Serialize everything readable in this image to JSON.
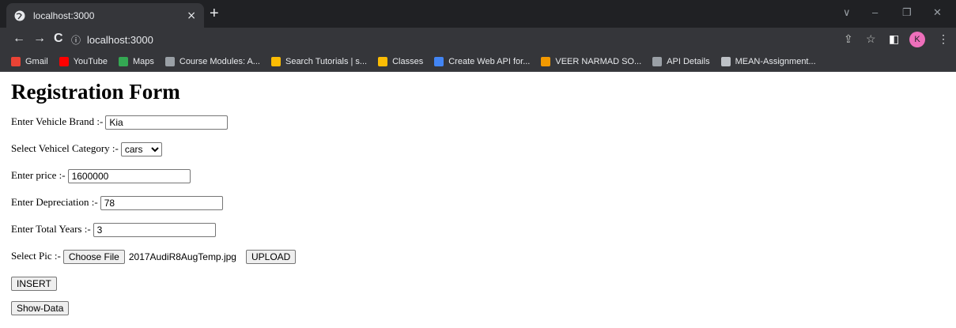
{
  "browser": {
    "tab_title": "localhost:3000",
    "tab_close": "×",
    "new_tab": "+",
    "window_controls": {
      "chevron": "∨",
      "minimize": "–",
      "restore": "❐",
      "close": "✕"
    },
    "nav": {
      "back": "←",
      "forward": "→",
      "reload": "C"
    },
    "url": "localhost:3000",
    "info_glyph": "ⓘ",
    "toolbar_icons": {
      "share": "⇪",
      "star": "☆",
      "sidebar": "◧",
      "menu": "⋮"
    },
    "avatar_letter": "K",
    "bookmarks": [
      {
        "label": "Gmail",
        "color": "#ea4335"
      },
      {
        "label": "YouTube",
        "color": "#ff0000"
      },
      {
        "label": "Maps",
        "color": "#34a853"
      },
      {
        "label": "Course Modules: A...",
        "color": "#9aa0a6"
      },
      {
        "label": "Search Tutorials | s...",
        "color": "#fbbc04"
      },
      {
        "label": "Classes",
        "color": "#fbbc04"
      },
      {
        "label": "Create Web API for...",
        "color": "#4285f4"
      },
      {
        "label": "VEER NARMAD SO...",
        "color": "#f29900"
      },
      {
        "label": "API Details",
        "color": "#9aa0a6"
      },
      {
        "label": "MEAN-Assignment...",
        "color": "#bdc1c6"
      }
    ]
  },
  "form": {
    "title": "Registration Form",
    "brand_label": "Enter Vehicle Brand :-",
    "brand_value": "Kia",
    "category_label": "Select Vehicel Category :-",
    "category_value": "cars",
    "price_label": "Enter price :-",
    "price_value": "1600000",
    "depreciation_label": "Enter Depreciation :-",
    "depreciation_value": "78",
    "years_label": "Enter Total Years :-",
    "years_value": "3",
    "pic_label": "Select Pic :-",
    "choose_file_label": "Choose File",
    "file_name": "2017AudiR8AugTemp.jpg",
    "upload_label": "UPLOAD",
    "insert_label": "INSERT",
    "show_data_label": "Show-Data"
  }
}
